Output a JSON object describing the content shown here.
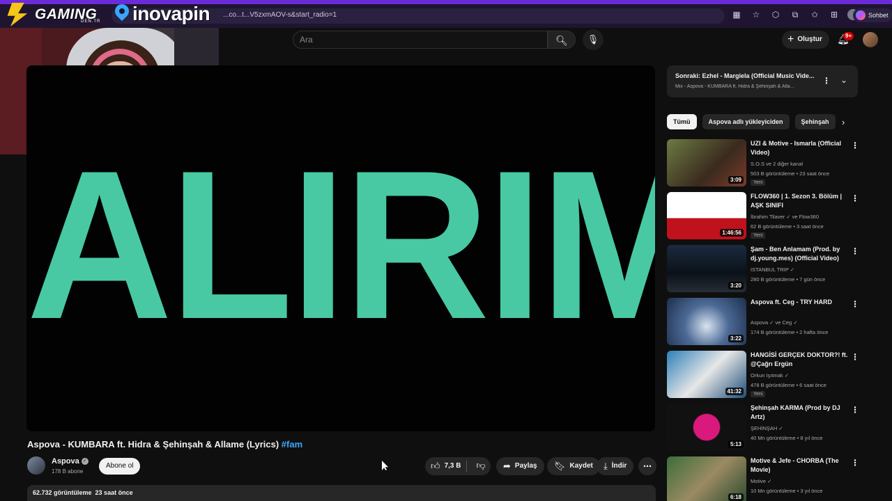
{
  "browser": {
    "url": "...co...t...V5zxmAOV-s&start_radio=1",
    "chat_button": "Sohbet",
    "brand_gaming": "GAMING",
    "brand_gaming_sub": "DEN.TR",
    "brand_ino": "inovapin"
  },
  "header": {
    "search_placeholder": "Ara",
    "create_label": "Oluştur",
    "notification_count": "9+"
  },
  "player": {
    "overlay_text": "ALIRIM",
    "overlay_color": "#48c9a3"
  },
  "video": {
    "title": "Aspova - KUMBARA ft. Hidra & Şehinşah & Allame (Lyrics)",
    "hashtag": "#fam",
    "channel": "Aspova",
    "subscribers": "178 B abone",
    "subscribe_label": "Abone ol",
    "likes": "7,3 B",
    "share_label": "Paylaş",
    "save_label": "Kaydet",
    "download_label": "İndir",
    "views": "62.732 görüntüleme",
    "posted": "23 saat önce"
  },
  "sidebar": {
    "next_title": "Sonraki: Ezhel - Margiela (Official Music Vide...",
    "next_sub": "Mix - Aspova - KUMBARA ft. Hidra & Şehinşah & Alla...",
    "chips": [
      "Tümü",
      "Aspova adlı yükleyiciden",
      "Şehinşah"
    ],
    "recommendations": [
      {
        "title": "UZI & Motive - Ismarla (Official Video)",
        "channel": "S.O.S ve 2 diğer kanal",
        "views": "503 B görüntüleme • 23 saat önce",
        "duration": "3:09",
        "badge": "Yeni"
      },
      {
        "title": "FLOW360 | 1. Sezon 3. Bölüm | AŞK SINIFI",
        "channel": "İbrahim Tilaver ✓ ve Flow360",
        "views": "62 B görüntüleme • 3 saat önce",
        "duration": "1:46:56",
        "badge": "Yeni"
      },
      {
        "title": "Şam - Ben Anlamam (Prod. by dj.young.mes) (Official Video)",
        "channel": "ISTANBUL TRIP ✓",
        "views": "280 B görüntüleme • 7 gün önce",
        "duration": "3:20",
        "badge": ""
      },
      {
        "title": "Aspova ft. Ceg - TRY HARD",
        "channel": "Aspova ✓ ve Ceg ✓",
        "views": "174 B görüntüleme • 2 hafta önce",
        "duration": "3:22",
        "badge": ""
      },
      {
        "title": "HANGİSİ GERÇEK DOKTOR?! ft. @Çağrı Ergün",
        "channel": "Orkun Işıtmak ✓",
        "views": "478 B görüntüleme • 6 saat önce",
        "duration": "41:32",
        "badge": "Yeni"
      },
      {
        "title": "Şehinşah KARMA (Prod by DJ Artz)",
        "channel": "ŞEHİNŞAH ✓",
        "views": "40 Mn görüntüleme • 8 yıl önce",
        "duration": "5:13",
        "badge": ""
      },
      {
        "title": "Motive & Jefe - CHORBA (The Movie)",
        "channel": "Motive ✓",
        "views": "10 Mn görüntüleme • 3 yıl önce",
        "duration": "6:18",
        "badge": ""
      }
    ]
  }
}
